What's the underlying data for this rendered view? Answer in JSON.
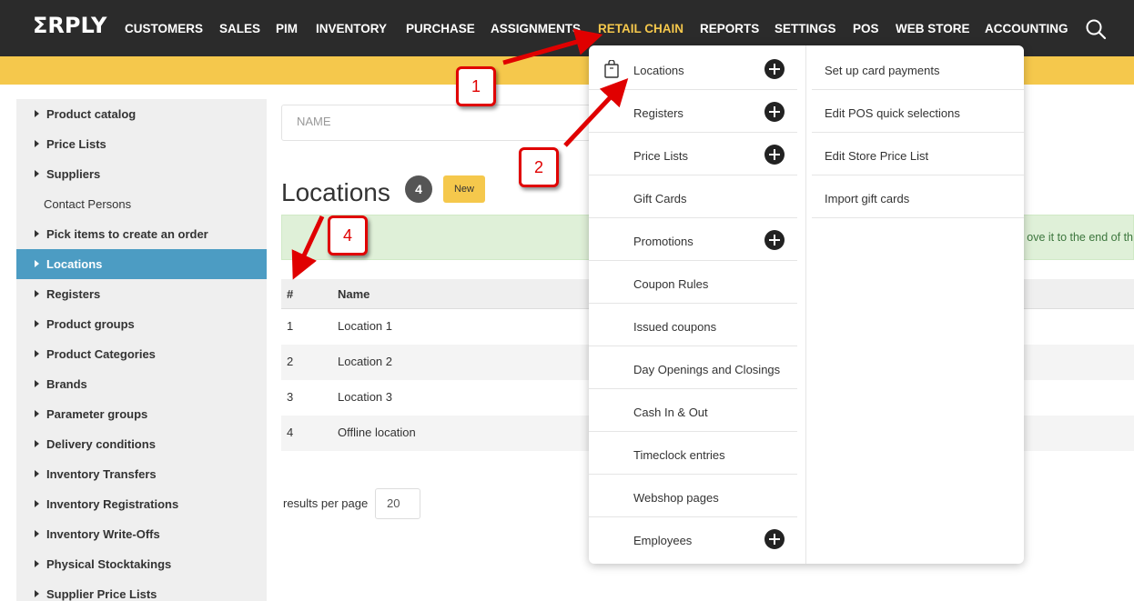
{
  "app": {
    "logo": "ΣRPLY"
  },
  "nav": {
    "items": [
      "CUSTOMERS",
      "SALES",
      "PIM",
      "INVENTORY",
      "PURCHASE",
      "ASSIGNMENTS",
      "RETAIL CHAIN",
      "REPORTS",
      "SETTINGS",
      "POS",
      "WEB STORE",
      "ACCOUNTING"
    ],
    "active": "RETAIL CHAIN",
    "search_icon": "search-icon"
  },
  "sidebar": {
    "items": [
      {
        "label": "Product catalog",
        "caret": true
      },
      {
        "label": "Price Lists",
        "caret": true
      },
      {
        "label": "Suppliers",
        "caret": true
      },
      {
        "label": "Contact Persons",
        "caret": false
      },
      {
        "label": "Pick items to create an order",
        "caret": true
      },
      {
        "label": "Locations",
        "caret": true,
        "active": true
      },
      {
        "label": "Registers",
        "caret": true
      },
      {
        "label": "Product groups",
        "caret": true
      },
      {
        "label": "Product Categories",
        "caret": true
      },
      {
        "label": "Brands",
        "caret": true
      },
      {
        "label": "Parameter groups",
        "caret": true
      },
      {
        "label": "Delivery conditions",
        "caret": true
      },
      {
        "label": "Inventory Transfers",
        "caret": true
      },
      {
        "label": "Inventory Registrations",
        "caret": true
      },
      {
        "label": "Inventory Write-Offs",
        "caret": true
      },
      {
        "label": "Physical Stocktakings",
        "caret": true
      },
      {
        "label": "Supplier Price Lists",
        "caret": true
      }
    ]
  },
  "main": {
    "name_placeholder": "NAME",
    "title": "Locations",
    "count": "4",
    "new_label": "New",
    "info_text": "ove it to the end of th",
    "table": {
      "headers": [
        "#",
        "Name"
      ],
      "rows": [
        [
          "1",
          "Location 1"
        ],
        [
          "2",
          "Location 2"
        ],
        [
          "3",
          "Location 3"
        ],
        [
          "4",
          "Offline location"
        ]
      ]
    },
    "results_per_page_label": "results per page",
    "results_per_page_value": "20"
  },
  "dropdown": {
    "left": [
      {
        "label": "Locations",
        "plus": true,
        "icon": "bag-icon"
      },
      {
        "label": "Registers",
        "plus": true
      },
      {
        "label": "Price Lists",
        "plus": true
      },
      {
        "label": "Gift Cards",
        "plus": false
      },
      {
        "label": "Promotions",
        "plus": true
      },
      {
        "label": "Coupon Rules",
        "plus": false
      },
      {
        "label": "Issued coupons",
        "plus": false
      },
      {
        "label": "Day Openings and Closings",
        "plus": false
      },
      {
        "label": "Cash In & Out",
        "plus": false
      },
      {
        "label": "Timeclock entries",
        "plus": false
      },
      {
        "label": "Webshop pages",
        "plus": false
      },
      {
        "label": "Employees",
        "plus": true
      }
    ],
    "right": [
      {
        "label": "Set up card payments"
      },
      {
        "label": "Edit POS quick selections"
      },
      {
        "label": "Edit Store Price List"
      },
      {
        "label": "Import gift cards"
      }
    ]
  },
  "annotations": [
    "1",
    "2",
    "4"
  ],
  "colors": {
    "nav_bg": "#2b2b2b",
    "accent_yellow": "#f5c84c",
    "active_blue": "#4c9cc3",
    "annotation_red": "#e00000",
    "info_green": "#dff0d8"
  }
}
